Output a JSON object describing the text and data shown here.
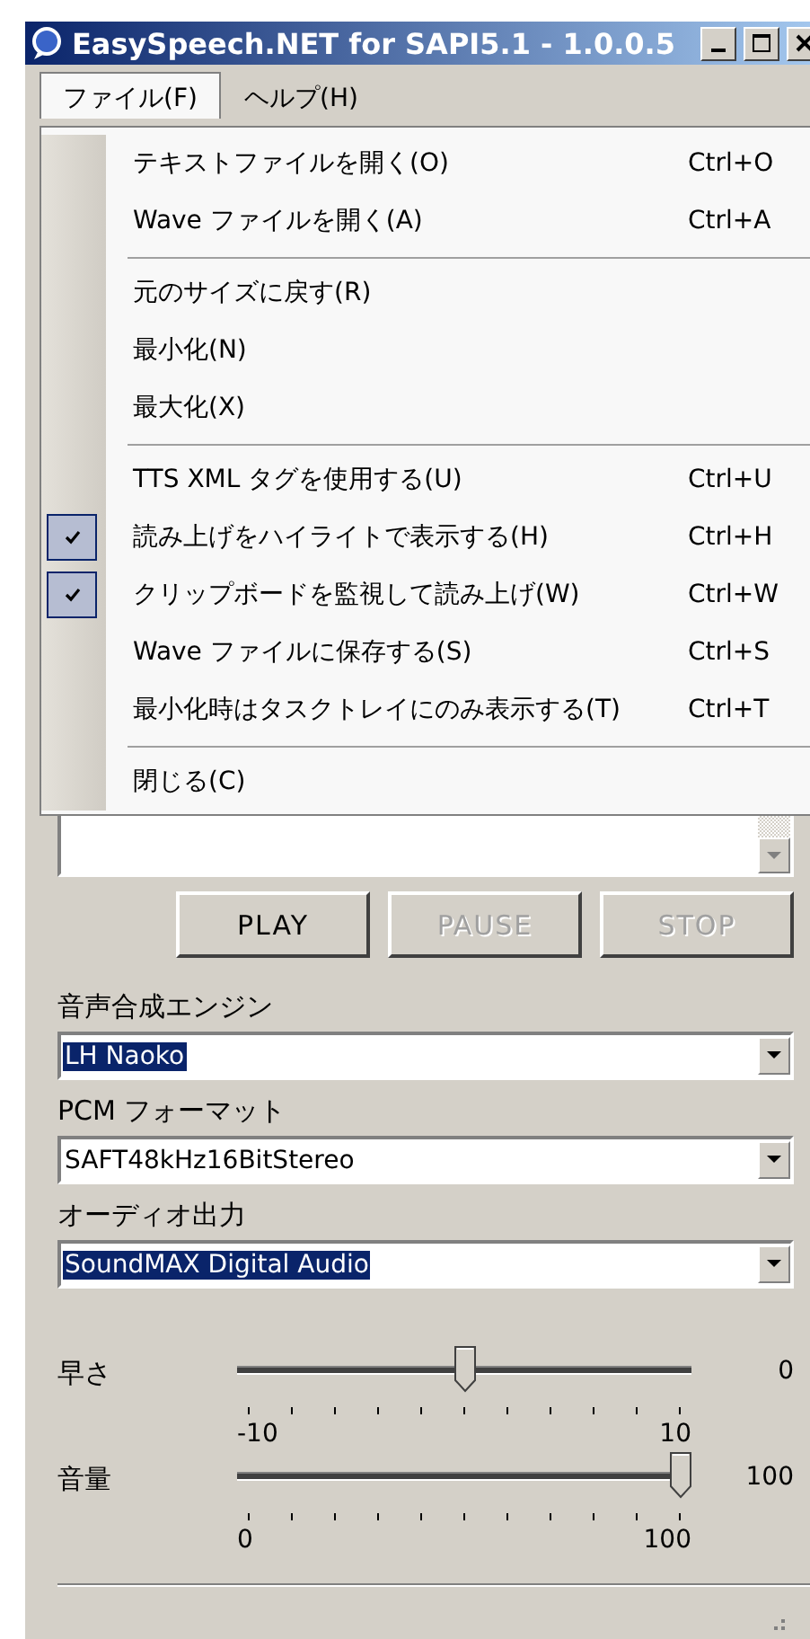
{
  "window": {
    "title": "EasySpeech.NET for SAPI5.1 - 1.0.0.5"
  },
  "menubar": [
    {
      "label": "ファイル(F)",
      "selected": true
    },
    {
      "label": "ヘルプ(H)",
      "selected": false
    }
  ],
  "menu": [
    {
      "kind": "item",
      "label": "テキストファイルを開く(O)",
      "shortcut": "Ctrl+O",
      "checked": false
    },
    {
      "kind": "item",
      "label": "Wave ファイルを開く(A)",
      "shortcut": "Ctrl+A",
      "checked": false
    },
    {
      "kind": "separator"
    },
    {
      "kind": "item",
      "label": "元のサイズに戻す(R)",
      "checked": false
    },
    {
      "kind": "item",
      "label": "最小化(N)",
      "checked": false
    },
    {
      "kind": "item",
      "label": "最大化(X)",
      "checked": false
    },
    {
      "kind": "separator"
    },
    {
      "kind": "item",
      "label": "TTS XML タグを使用する(U)",
      "shortcut": "Ctrl+U",
      "checked": false
    },
    {
      "kind": "item",
      "label": "読み上げをハイライトで表示する(H)",
      "shortcut": "Ctrl+H",
      "checked": true
    },
    {
      "kind": "item",
      "label": "クリップボードを監視して読み上げ(W)",
      "shortcut": "Ctrl+W",
      "checked": true
    },
    {
      "kind": "item",
      "label": "Wave ファイルに保存する(S)",
      "shortcut": "Ctrl+S",
      "checked": false
    },
    {
      "kind": "item",
      "label": "最小化時はタスクトレイにのみ表示する(T)",
      "shortcut": "Ctrl+T",
      "checked": false
    },
    {
      "kind": "separator"
    },
    {
      "kind": "item",
      "label": "閉じる(C)",
      "checked": false
    }
  ],
  "buttons": [
    {
      "label": "PLAY",
      "disabled": false
    },
    {
      "label": "PAUSE",
      "disabled": true
    },
    {
      "label": "STOP",
      "disabled": true
    }
  ],
  "combos": [
    {
      "label": "音声合成エンジン",
      "value": "LH Naoko",
      "highlighted": true
    },
    {
      "label": "PCM フォーマット",
      "value": "SAFT48kHz16BitStereo",
      "highlighted": false
    },
    {
      "label": "オーディオ出力",
      "value": "SoundMAX Digital Audio",
      "highlighted": true
    }
  ],
  "sliders": [
    {
      "label": "早さ",
      "level": 0.5,
      "reading": "0",
      "min": "-10",
      "max": "10"
    },
    {
      "label": "音量",
      "level": 1,
      "reading": "100",
      "min": "0",
      "max": "100"
    }
  ]
}
